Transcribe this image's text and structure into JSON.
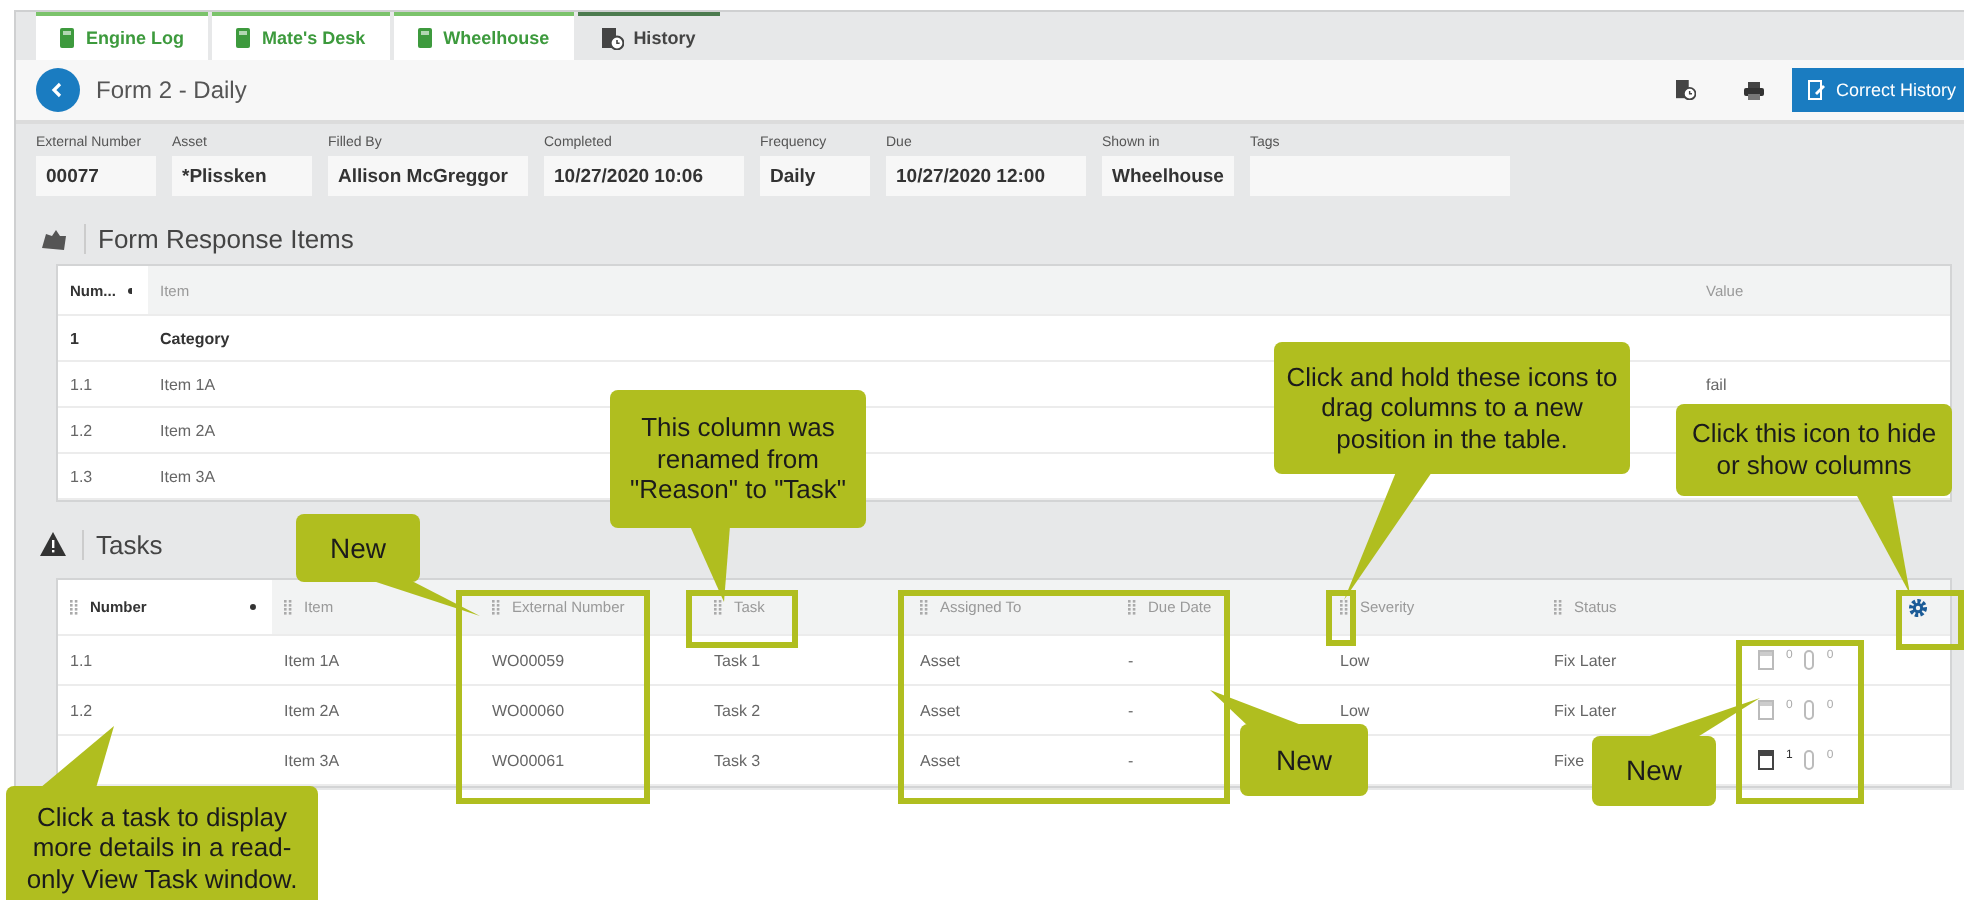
{
  "tabs": [
    {
      "label": "Engine Log",
      "selected": false
    },
    {
      "label": "Mate's Desk",
      "selected": false
    },
    {
      "label": "Wheelhouse",
      "selected": false
    },
    {
      "label": "History",
      "selected": true
    }
  ],
  "header": {
    "title": "Form 2 - Daily",
    "action_button": "Correct History"
  },
  "fields": [
    {
      "label": "External Number",
      "value": "00077"
    },
    {
      "label": "Asset",
      "value": "*Plissken"
    },
    {
      "label": "Filled By",
      "value": "Allison McGreggor"
    },
    {
      "label": "Completed",
      "value": "10/27/2020 10:06"
    },
    {
      "label": "Frequency",
      "value": "Daily"
    },
    {
      "label": "Due",
      "value": "10/27/2020 12:00"
    },
    {
      "label": "Shown in",
      "value": "Wheelhouse"
    },
    {
      "label": "Tags"
    }
  ],
  "form_items": {
    "title": "Form Response Items",
    "columns": [
      {
        "label": "Num...",
        "sorted": true
      },
      {
        "label": "Item",
        "sorted": false
      },
      {
        "label": "Value",
        "sorted": false
      }
    ],
    "rows": [
      {
        "kind": "category",
        "number": "1",
        "item": "Category"
      },
      {
        "kind": "item",
        "number": "1.1",
        "item": "Item 1A",
        "value": "fail"
      },
      {
        "kind": "item",
        "number": "1.2",
        "item": "Item 2A"
      },
      {
        "kind": "item",
        "number": "1.3",
        "item": "Item 3A"
      }
    ]
  },
  "tasks": {
    "title": "Tasks",
    "columns": [
      {
        "label": "Number",
        "sorted": true
      },
      {
        "label": "Item",
        "sorted": false
      },
      {
        "label": "External Number",
        "sorted": false
      },
      {
        "label": "Task",
        "sorted": false
      },
      {
        "label": "Assigned To",
        "sorted": false
      },
      {
        "label": "Due Date",
        "sorted": false
      },
      {
        "label": "Severity",
        "sorted": false
      },
      {
        "label": "Status",
        "sorted": false
      }
    ],
    "rows": [
      {
        "number": "1.1",
        "item": "Item 1A",
        "external_number": "WO00059",
        "task": "Task 1",
        "assigned_to": "Asset",
        "due_date": "-",
        "severity": "Low",
        "status": "Fix Later",
        "comments": "0",
        "has_comments": false,
        "attachments": "0"
      },
      {
        "number": "1.2",
        "item": "Item 2A",
        "external_number": "WO00060",
        "task": "Task 2",
        "assigned_to": "Asset",
        "due_date": "-",
        "severity": "Low",
        "status": "Fix Later",
        "comments": "0",
        "has_comments": false,
        "attachments": "0"
      },
      {
        "item": "Item 3A",
        "external_number": "WO00061",
        "task": "Task 3",
        "assigned_to": "Asset",
        "due_date": "-",
        "status": "Fixe",
        "comments": "1",
        "has_comments": true,
        "attachments": "0"
      }
    ]
  },
  "callouts": [
    {
      "text": "New"
    },
    {
      "text": "This column was renamed from \"Reason\" to \"Task\""
    },
    {
      "text": "Click and hold these icons to drag columns to a new position in the table."
    },
    {
      "text": "Click this icon to hide or show columns"
    },
    {
      "text": "Click a task to display more details in a read-only View Task window."
    },
    {
      "text": "New"
    },
    {
      "text": "New"
    }
  ]
}
